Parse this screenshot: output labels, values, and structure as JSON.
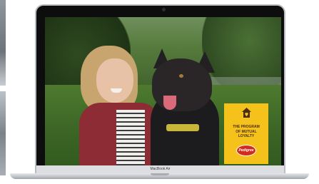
{
  "ad_card": {
    "headline_lines": [
      "THE PROGRAM",
      "OF MUTUAL",
      "LOYALTY"
    ],
    "brand": "Pedigree",
    "icon": "house-heart-icon",
    "background_color": "#f4c21b"
  },
  "device": {
    "model_label": "MacBook Air"
  }
}
